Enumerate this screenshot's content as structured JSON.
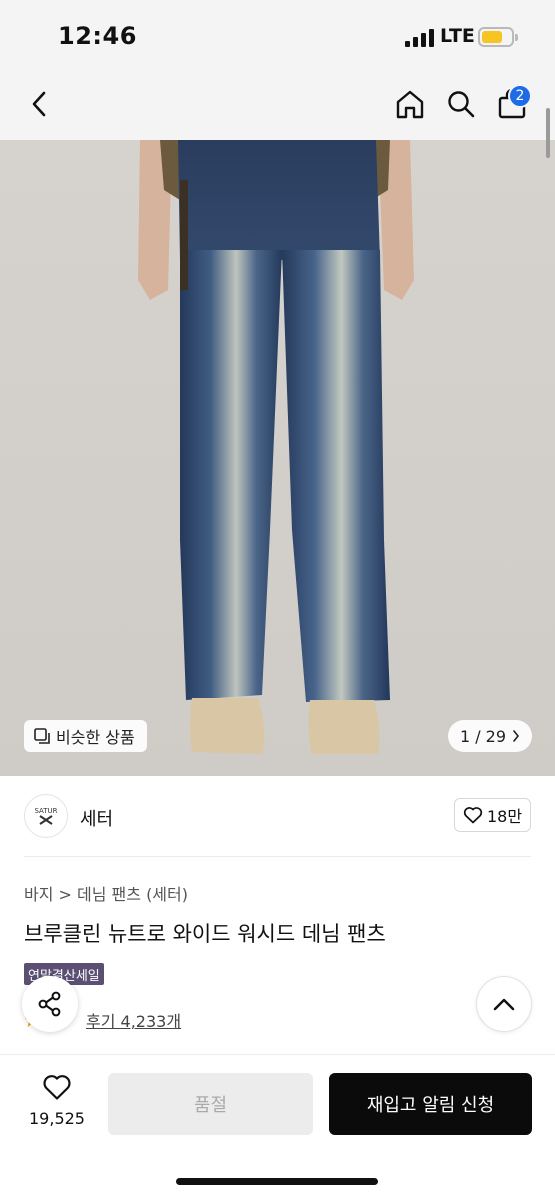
{
  "status": {
    "time": "12:46",
    "network": "LTE"
  },
  "nav": {
    "cart_count": "2"
  },
  "gallery": {
    "similar_label": "비슷한 상품",
    "counter": "1 / 29"
  },
  "brand": {
    "logo_text": "SATUR",
    "name": "세터",
    "likes": "18만"
  },
  "product": {
    "breadcrumb": "바지 > 데님 팬츠 (세터)",
    "title": "브루클린 뉴트로 와이드 워시드 데님 팬츠",
    "tag": "연말결산세일",
    "reviews": "후기 4,233개"
  },
  "bottom": {
    "wish_count": "19,525",
    "soldout_label": "품절",
    "restock_label": "재입고 알림 신청"
  },
  "colors": {
    "accent": "#1e6be6",
    "sale_tag": "#5b4f73",
    "primary_button": "#0b0b0b"
  }
}
